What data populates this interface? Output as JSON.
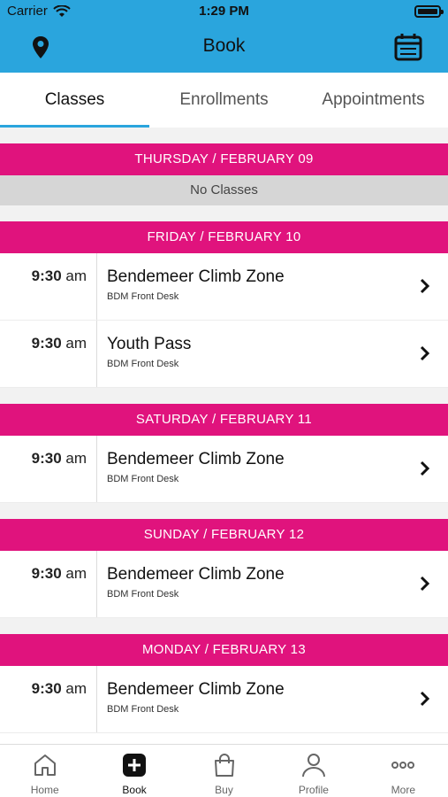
{
  "status_bar": {
    "carrier": "Carrier",
    "time": "1:29 PM"
  },
  "nav": {
    "title": "Book",
    "left_icon": "location-pin-icon",
    "right_icon": "calendar-icon"
  },
  "tabs": [
    {
      "label": "Classes",
      "active": true
    },
    {
      "label": "Enrollments",
      "active": false
    },
    {
      "label": "Appointments",
      "active": false
    }
  ],
  "days": [
    {
      "header": "THURSDAY / FEBRUARY 09",
      "empty_text": "No Classes",
      "classes": []
    },
    {
      "header": "FRIDAY / FEBRUARY 10",
      "classes": [
        {
          "time_num": "9:30",
          "time_suffix": " am",
          "name": "Bendemeer Climb Zone",
          "location": "BDM Front Desk"
        },
        {
          "time_num": "9:30",
          "time_suffix": " am",
          "name": "Youth Pass",
          "location": "BDM Front Desk"
        }
      ]
    },
    {
      "header": "SATURDAY / FEBRUARY 11",
      "classes": [
        {
          "time_num": "9:30",
          "time_suffix": " am",
          "name": "Bendemeer Climb Zone",
          "location": "BDM Front Desk"
        }
      ]
    },
    {
      "header": "SUNDAY / FEBRUARY 12",
      "classes": [
        {
          "time_num": "9:30",
          "time_suffix": " am",
          "name": "Bendemeer Climb Zone",
          "location": "BDM Front Desk"
        }
      ]
    },
    {
      "header": "MONDAY / FEBRUARY 13",
      "classes": [
        {
          "time_num": "9:30",
          "time_suffix": " am",
          "name": "Bendemeer Climb Zone",
          "location": "BDM Front Desk"
        }
      ]
    }
  ],
  "tab_bar": [
    {
      "label": "Home",
      "icon": "home-icon",
      "active": false
    },
    {
      "label": "Book",
      "icon": "plus-square-icon",
      "active": true
    },
    {
      "label": "Buy",
      "icon": "shopping-bag-icon",
      "active": false
    },
    {
      "label": "Profile",
      "icon": "person-icon",
      "active": false
    },
    {
      "label": "More",
      "icon": "more-dots-icon",
      "active": false
    }
  ],
  "colors": {
    "brand_blue": "#2aa5dd",
    "day_header_pink": "#e0137d",
    "no_classes_gray": "#d6d6d6"
  }
}
